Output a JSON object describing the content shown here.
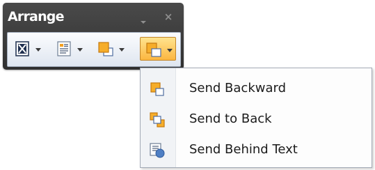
{
  "toolbar": {
    "title": "Arrange",
    "dropdown_icon": "small-down-triangle-icon",
    "close_glyph": "×",
    "buttons": [
      {
        "name": "bring-to-front",
        "icon": "picture-frame-icon",
        "active": false
      },
      {
        "name": "text-wrapping",
        "icon": "text-wrap-icon",
        "active": false
      },
      {
        "name": "bring-forward",
        "icon": "bring-forward-icon",
        "active": false
      },
      {
        "name": "send-backward",
        "icon": "send-backward-icon",
        "active": true
      }
    ]
  },
  "menu": {
    "items": [
      {
        "label": "Send Backward",
        "icon": "send-backward-icon"
      },
      {
        "label": "Send to Back",
        "icon": "send-to-back-icon"
      },
      {
        "label": "Send Behind Text",
        "icon": "send-behind-text-icon"
      }
    ]
  },
  "colors": {
    "header_bg": "#3c3c3c",
    "active_button": "#fbc85a",
    "orange_shape": "#f4a020",
    "blue_shape": "#4f7fc4"
  }
}
